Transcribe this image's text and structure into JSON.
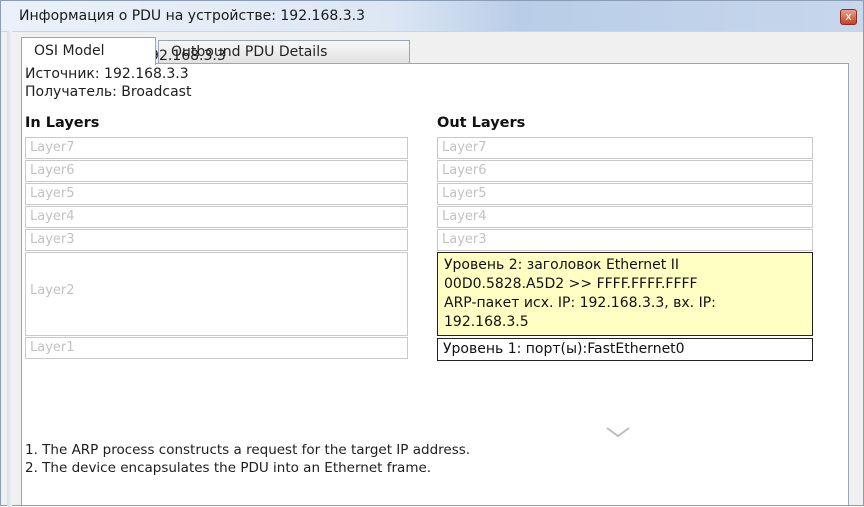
{
  "window": {
    "title": "Информация о PDU на устройстве: 192.168.3.3",
    "close_label": "x"
  },
  "tabs": [
    {
      "label": "OSI Model",
      "active": true
    },
    {
      "label": "Outbound PDU Details",
      "active": false
    }
  ],
  "info": {
    "device": "На устройстве: 192.168.3.3",
    "source": "Источник: 192.168.3.3",
    "destination": "Получатель: Broadcast"
  },
  "in_layers": {
    "heading": "In Layers",
    "layers": [
      "Layer7",
      "Layer6",
      "Layer5",
      "Layer4",
      "Layer3",
      "Layer2",
      "Layer1"
    ]
  },
  "out_layers": {
    "heading": "Out Layers",
    "layers": [
      "Layer7",
      "Layer6",
      "Layer5",
      "Layer4",
      "Layer3"
    ],
    "layer2": {
      "line1": "Уровень 2: заголовок Ethernet II",
      "line2": "00D0.5828.A5D2 >> FFFF.FFFF.FFFF",
      "line3": "ARP-пакет исх. IP: 192.168.3.3, вх. IP:",
      "line4": "192.168.3.5"
    },
    "layer1": "Уровень 1: порт(ы):FastEthernet0"
  },
  "steps": [
    "1. The ARP process constructs a request for the target IP address.",
    "2. The device encapsulates the PDU into an Ethernet frame."
  ],
  "colors": {
    "highlight": "#ffffc4",
    "titlebar_accent": "#b9cde8"
  }
}
